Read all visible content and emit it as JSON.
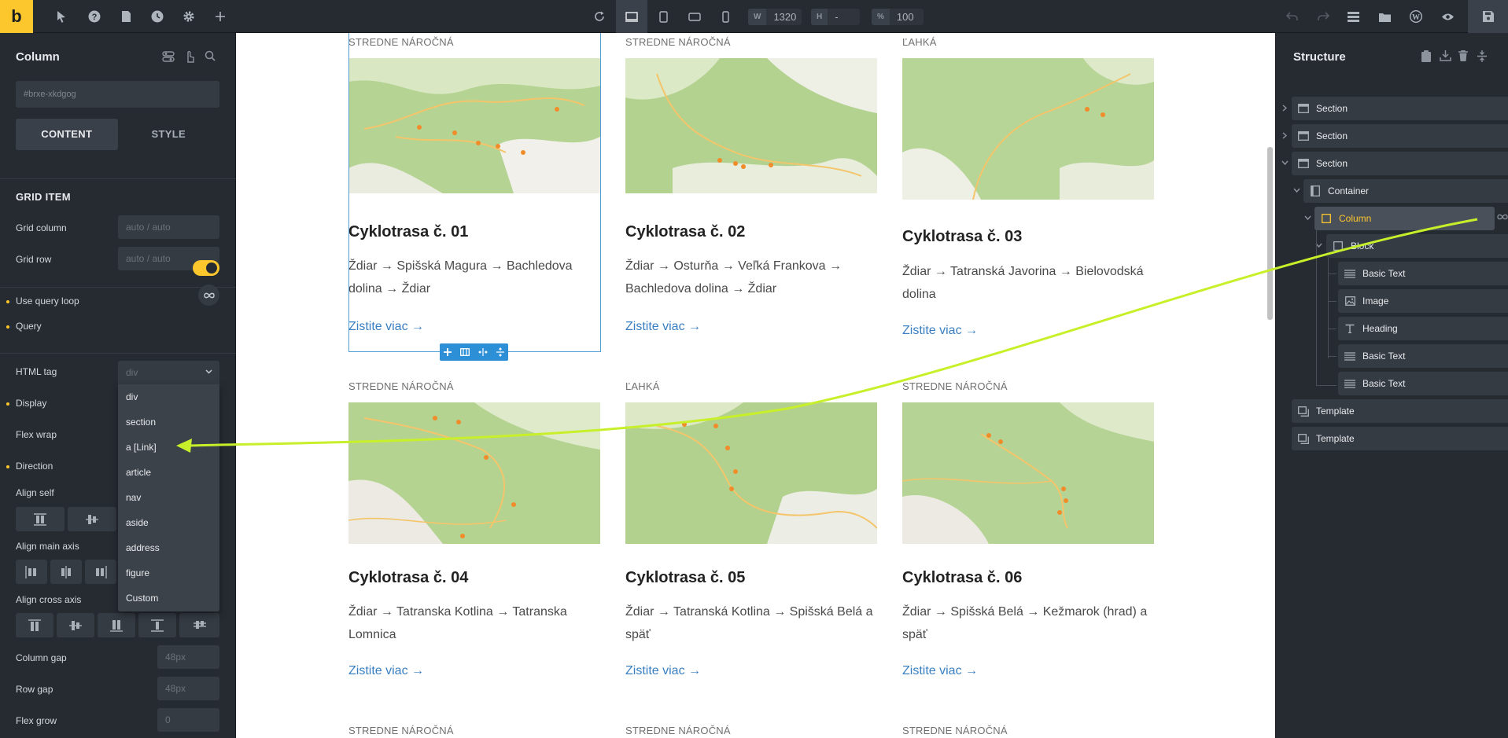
{
  "topbar": {
    "logo": "b",
    "width_label": "W",
    "width_value": "1320",
    "height_label": "H",
    "height_value": "-",
    "zoom_label": "%",
    "zoom_value": "100"
  },
  "left_panel": {
    "title": "Column",
    "element_id": "#brxe-xkdgog",
    "tabs": [
      "CONTENT",
      "STYLE"
    ],
    "grid_item_heading": "GRID ITEM",
    "grid_column_label": "Grid column",
    "grid_column_placeholder": "auto / auto",
    "grid_row_label": "Grid row",
    "grid_row_placeholder": "auto / auto",
    "use_query_loop_label": "Use query loop",
    "query_label": "Query",
    "html_tag_label": "HTML tag",
    "html_tag_value": "div",
    "html_tag_options": [
      "div",
      "section",
      "a [Link]",
      "article",
      "nav",
      "aside",
      "address",
      "figure",
      "Custom"
    ],
    "display_label": "Display",
    "flex_wrap_label": "Flex wrap",
    "direction_label": "Direction",
    "align_self_label": "Align self",
    "align_main_axis_label": "Align main axis",
    "align_cross_axis_label": "Align cross axis",
    "column_gap_label": "Column gap",
    "column_gap_placeholder": "48px",
    "row_gap_label": "Row gap",
    "row_gap_placeholder": "48px",
    "flex_grow_label": "Flex grow",
    "flex_grow_placeholder": "0"
  },
  "cards": [
    {
      "category": "STREDNE NÁROČNÁ",
      "title": "Cyklotrasa č. 01",
      "route": "Ždiar → Spišská Magura → Bachledova dolina → Ždiar",
      "more": "Zistite viac →"
    },
    {
      "category": "STREDNE NÁROČNÁ",
      "title": "Cyklotrasa č. 02",
      "route": "Ždiar → Osturňa → Veľká Frankova → Bachledova dolina → Ždiar",
      "more": "Zistite viac →"
    },
    {
      "category": "ĽAHKÁ",
      "title": "Cyklotrasa č. 03",
      "route": "Ždiar → Tatranská Javorina → Bielovodská dolina",
      "more": "Zistite viac →"
    },
    {
      "category": "STREDNE NÁROČNÁ",
      "title": "Cyklotrasa č. 04",
      "route": "Ždiar → Tatranska Kotlina → Tatranska Lomnica",
      "more": "Zistite viac →"
    },
    {
      "category": "ĽAHKÁ",
      "title": "Cyklotrasa č. 05",
      "route": "Ždiar → Tatranská Kotlina → Spišská Belá a späť",
      "more": "Zistite viac →"
    },
    {
      "category": "STREDNE NÁROČNÁ",
      "title": "Cyklotrasa č. 06",
      "route": "Ždiar → Spišská Belá → Kežmarok (hrad) a späť",
      "more": "Zistite viac →"
    }
  ],
  "next_row_categories": [
    "STREDNE NÁROČNÁ",
    "STREDNE NÁROČNÁ",
    "STREDNE NÁROČNÁ"
  ],
  "structure": {
    "title": "Structure",
    "nodes": [
      "Section",
      "Section",
      "Section",
      "Container",
      "Column",
      "Block",
      "Basic Text",
      "Image",
      "Heading",
      "Basic Text",
      "Basic Text",
      "Template",
      "Template"
    ]
  },
  "colors": {
    "accent": "#fcc72d",
    "selection": "#2d8fd5",
    "link": "#3a7fc1",
    "annotation_arrow": "#c8f02a"
  }
}
